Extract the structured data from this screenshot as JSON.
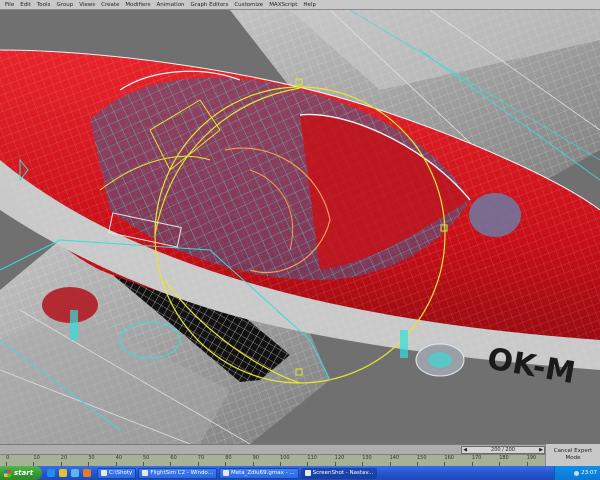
{
  "menu": {
    "items": [
      "File",
      "Edit",
      "Tools",
      "Group",
      "Views",
      "Create",
      "Modifiers",
      "Animation",
      "Graph Editors",
      "Customize",
      "MAXScript",
      "Help"
    ]
  },
  "viewport": {
    "registration_text": "OK-M"
  },
  "timeline": {
    "frame_display": "200 / 200",
    "prev_icon": "chevron-left-icon",
    "next_icon": "chevron-right-icon"
  },
  "ruler": {
    "ticks": [
      "0",
      "10",
      "20",
      "30",
      "40",
      "50",
      "60",
      "70",
      "80",
      "90",
      "100",
      "110",
      "120",
      "130",
      "140",
      "150",
      "160",
      "170",
      "180",
      "190"
    ]
  },
  "expert_mode": {
    "label": "Cancel Expert Mode"
  },
  "taskbar": {
    "start_label": "start",
    "quick_launch": [
      "ie-icon",
      "outlook-icon",
      "desktop-icon",
      "media-icon"
    ],
    "quick_launch_colors": [
      "#2a8ce6",
      "#e6c12a",
      "#58b8e8",
      "#e67a2a"
    ],
    "buttons": [
      {
        "label": "C:\\Shoty",
        "active": false
      },
      {
        "label": "FlightSim C2 - Windo...",
        "active": false
      },
      {
        "label": "Meta_Zdiu69.gmax - ...",
        "active": false
      },
      {
        "label": "ScreenShot - Nastav...",
        "active": true
      }
    ],
    "clock": "23:07"
  },
  "colors": {
    "fuselage_red": "#d3121d",
    "wireframe_cyan": "#30e0dc",
    "wireframe_white": "#f0f0f0",
    "gizmo_yellow": "#e4e630",
    "selected_orange": "#f0a050",
    "wing_gray": "#9a9a9a"
  }
}
